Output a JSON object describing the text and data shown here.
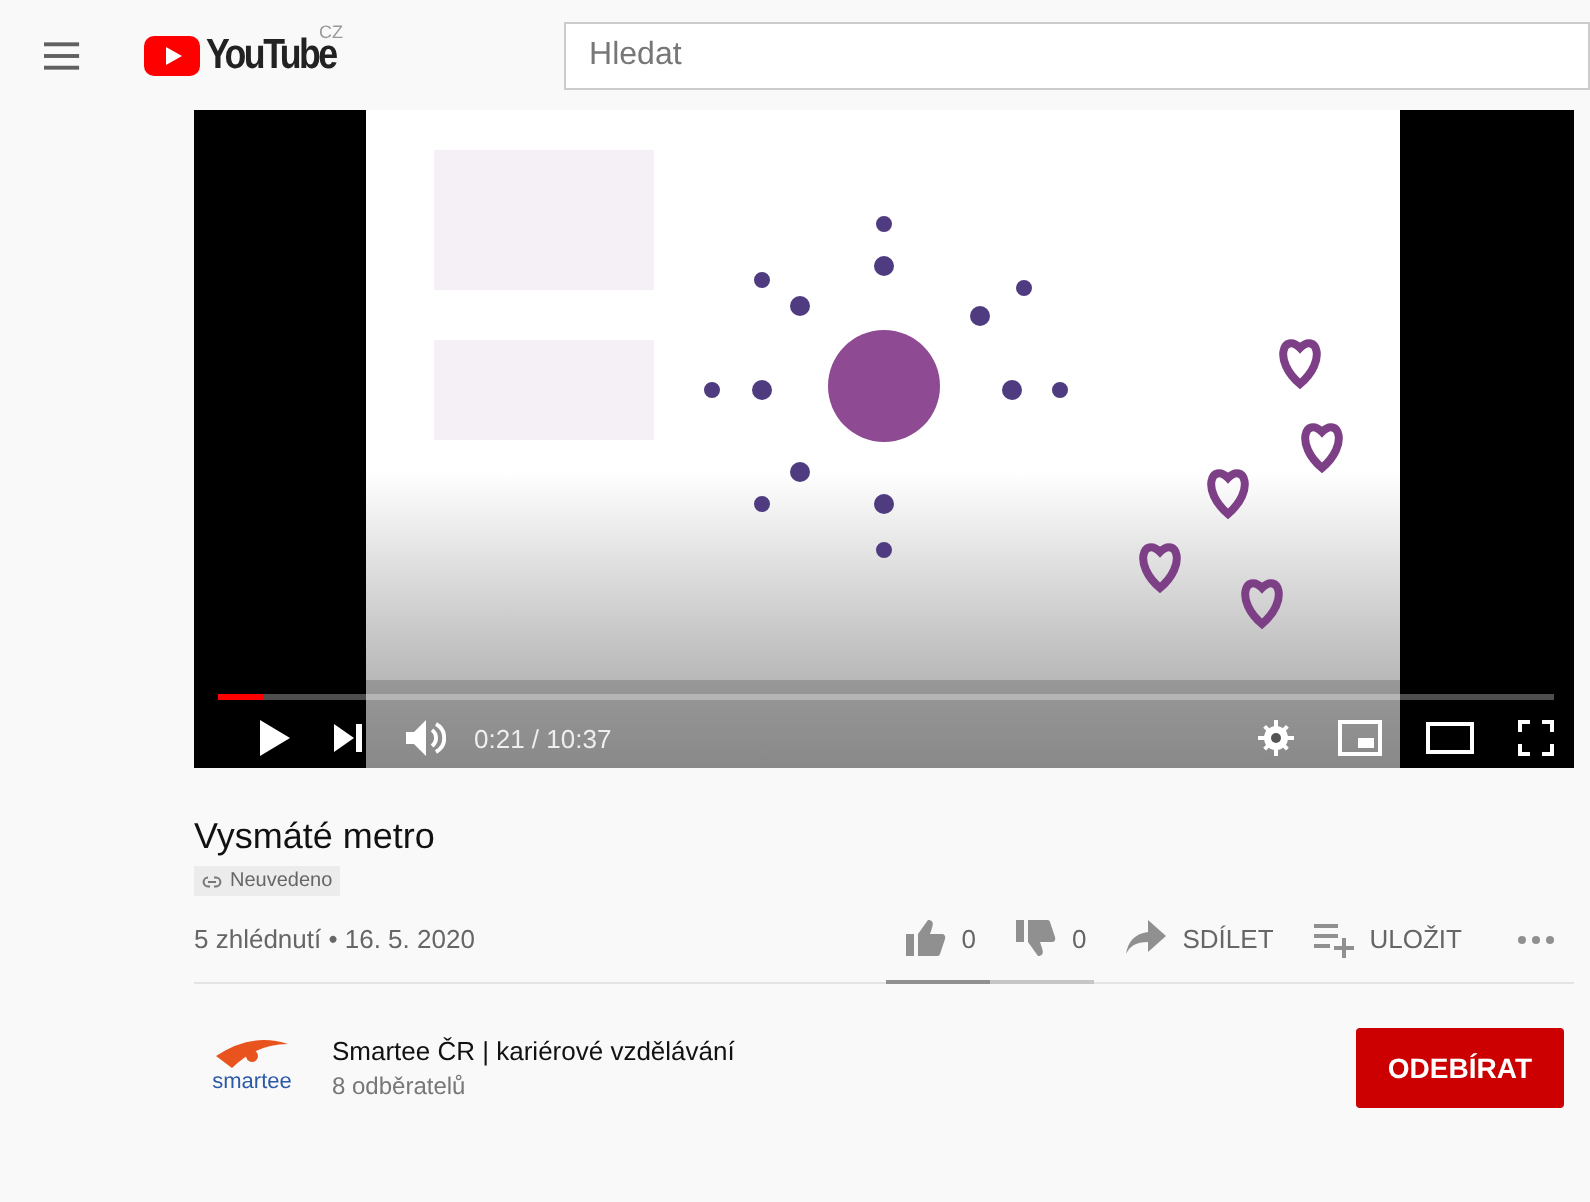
{
  "header": {
    "logo": {
      "text": "YouTube",
      "region": "CZ"
    },
    "search": {
      "placeholder": "Hledat"
    }
  },
  "video": {
    "kind": "picture",
    "progress": {
      "level": 0.034
    },
    "time": "0:21 / 10:37"
  },
  "title": "Vysmáté metro",
  "badge": "Neuvedeno",
  "meta": "5 zhlédnutí • 16. 5. 2020",
  "actions": [
    {
      "kind": "like",
      "label": "0"
    },
    {
      "kind": "dislike",
      "label": "0"
    },
    {
      "kind": "share",
      "label": "SDÍLET"
    },
    {
      "kind": "save",
      "label": "ULOŽIT"
    },
    {
      "kind": "more"
    }
  ],
  "like_bar": {
    "level": 0.5
  },
  "channel": {
    "logo_text": "smartee",
    "name": "Smartee ČR | kariérové vzdělávání",
    "subscribers": "8 odběratelů",
    "subscribe": "ODEBÍRAT"
  }
}
